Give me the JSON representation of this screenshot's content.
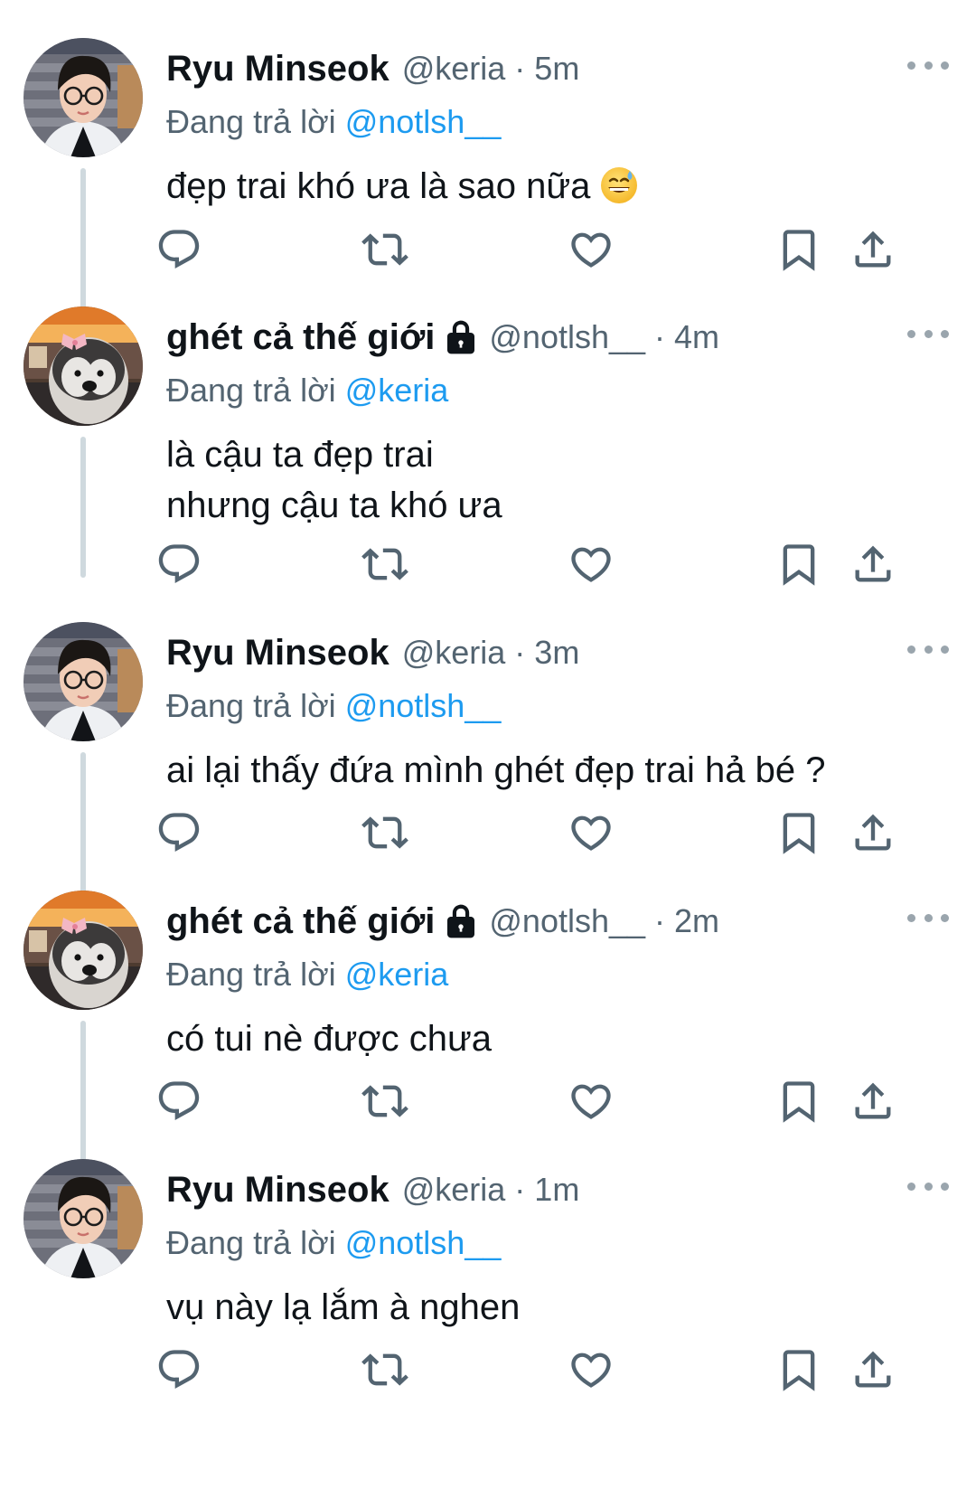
{
  "reply_prefix": "Đang trả lời",
  "tweets": [
    {
      "name": "Ryu Minseok",
      "handle": "@keria",
      "time": "5m",
      "reply_to": "@notlsh__",
      "text": "đẹp trai khó ưa là sao nữa",
      "has_emoji": true,
      "emoji_name": "grinning-face-with-sweat-icon",
      "avatar": "person-with-glasses",
      "locked": false
    },
    {
      "name": "ghét cả thế giới",
      "handle": "@notlsh__",
      "time": "4m",
      "reply_to": "@keria",
      "text": "là cậu ta đẹp trai\nnhưng cậu ta khó ưa",
      "avatar": "penguin-plush",
      "locked": true
    },
    {
      "name": "Ryu Minseok",
      "handle": "@keria",
      "time": "3m",
      "reply_to": "@notlsh__",
      "text": "ai lại thấy đứa mình ghét đẹp trai hả bé ?",
      "avatar": "person-with-glasses",
      "locked": false
    },
    {
      "name": "ghét cả thế giới",
      "handle": "@notlsh__",
      "time": "2m",
      "reply_to": "@keria",
      "text": "có tui nè được chưa",
      "avatar": "penguin-plush",
      "locked": true
    },
    {
      "name": "Ryu Minseok",
      "handle": "@keria",
      "time": "1m",
      "reply_to": "@notlsh__",
      "text": "vụ này lạ lắm à nghen",
      "avatar": "person-with-glasses",
      "locked": false
    }
  ],
  "colors": {
    "text": "#0f1419",
    "secondary": "#536471",
    "link": "#1d9bf0",
    "thread_line": "#cfd9de"
  }
}
